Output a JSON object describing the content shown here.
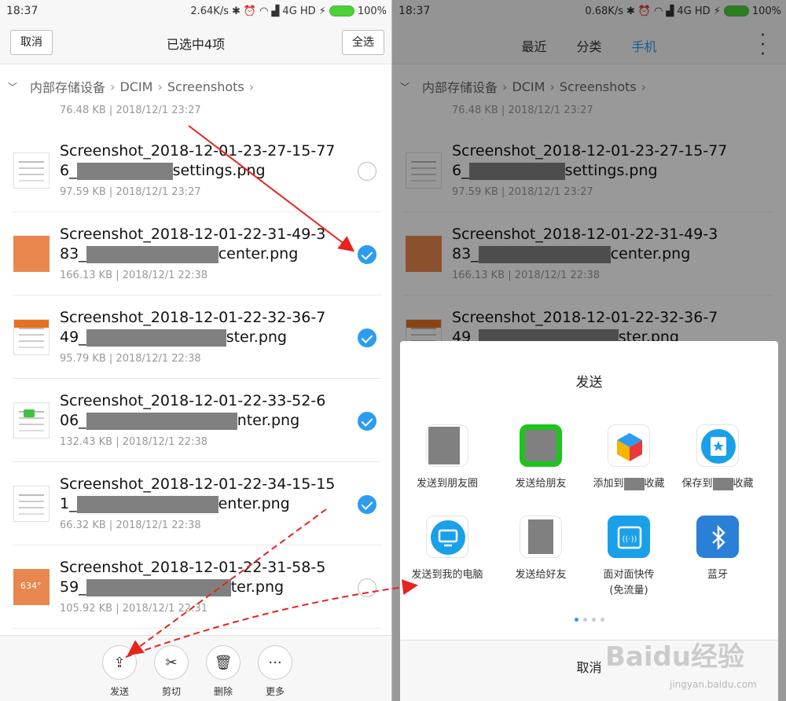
{
  "left": {
    "status": {
      "time": "18:37",
      "speed": "2.64K/s",
      "network": "4G HD",
      "battery": "100%"
    },
    "header": {
      "cancel_label": "取消",
      "title": "已选中4项",
      "select_all_label": "全选"
    },
    "breadcrumb": [
      "内部存储设备",
      "DCIM",
      "Screenshots"
    ],
    "top_partial_meta": {
      "size": "76.48 KB",
      "date": "2018/12/1 23:27"
    },
    "files": [
      {
        "name1": "Screenshot_2018-12-01-23-27-15-77",
        "name2_pre": "6_",
        "name2_post": "settings.png",
        "size": "97.59 KB",
        "date": "2018/12/1 23:27",
        "checked": false
      },
      {
        "name1": "Screenshot_2018-12-01-22-31-49-3",
        "name2_pre": "83_",
        "name2_post": "center.png",
        "size": "166.13 KB",
        "date": "2018/12/1 22:38",
        "checked": true
      },
      {
        "name1": "Screenshot_2018-12-01-22-32-36-7",
        "name2_pre": "49_",
        "name2_post": "ster.png",
        "size": "95.79 KB",
        "date": "2018/12/1 22:38",
        "checked": true
      },
      {
        "name1": "Screenshot_2018-12-01-22-33-52-6",
        "name2_pre": "06_",
        "name2_post": "nter.png",
        "size": "132.43 KB",
        "date": "2018/12/1 22:38",
        "checked": true
      },
      {
        "name1": "Screenshot_2018-12-01-22-34-15-15",
        "name2_pre": "1_",
        "name2_post": "enter.png",
        "size": "66.32 KB",
        "date": "2018/12/1 22:38",
        "checked": true
      },
      {
        "name1": "Screenshot_2018-12-01-22-31-58-5",
        "name2_pre": "59_",
        "name2_post": "ter.png",
        "size": "105.92 KB",
        "date": "2018/12/1 22:31",
        "checked": false
      }
    ],
    "thumb_text": "634°",
    "bottom_actions": [
      "发送",
      "剪切",
      "删除",
      "更多"
    ]
  },
  "right": {
    "status": {
      "time": "18:37",
      "speed": "0.68K/s",
      "network": "4G HD",
      "battery": "100%"
    },
    "tabs": [
      "最近",
      "分类",
      "手机"
    ],
    "active_tab": "手机",
    "breadcrumb": [
      "内部存储设备",
      "DCIM",
      "Screenshots"
    ],
    "sheet": {
      "title": "发送",
      "apps": [
        {
          "label": "发送到朋友圈",
          "icon": "moments-icon"
        },
        {
          "label": "发送给朋友",
          "icon": "wechat-icon"
        },
        {
          "label": "添加到",
          "label2": "收藏",
          "icon": "favorites-cube-icon"
        },
        {
          "label": "保存到",
          "label2": "收藏",
          "icon": "star-save-icon"
        },
        {
          "label": "发送到我的电脑",
          "icon": "monitor-icon"
        },
        {
          "label": "发送给好友",
          "icon": "qq-icon"
        },
        {
          "label": "面对面快传",
          "label2": "(免流量)",
          "icon": "face-transfer-icon"
        },
        {
          "label": "蓝牙",
          "icon": "bluetooth-icon"
        }
      ],
      "cancel_label": "取消",
      "page_count": 4,
      "active_page": 1
    }
  },
  "watermark": {
    "main": "Baidu经验",
    "sub": "jingyan.baidu.com"
  },
  "colors": {
    "accent": "#2d9cf0",
    "annotation": "#e8231e"
  }
}
